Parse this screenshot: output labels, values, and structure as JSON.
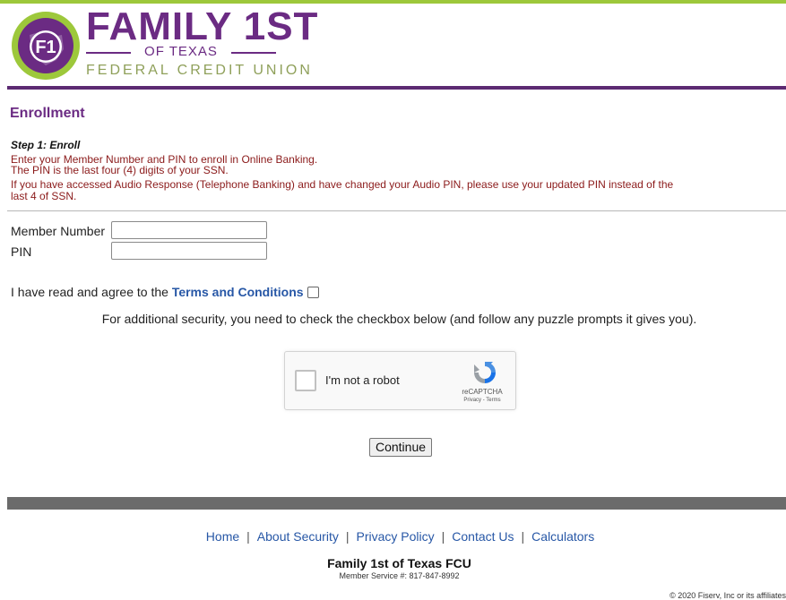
{
  "header": {
    "logo": {
      "emblem_text": "F1",
      "line1": "FAMILY 1ST",
      "line2": "OF TEXAS",
      "line3": "FEDERAL CREDIT UNION"
    }
  },
  "colors": {
    "brand_purple": "#6b2b83",
    "accent_green": "#9dc83b",
    "instruction_red": "#8b1a1a",
    "link_blue": "#2757a6"
  },
  "main": {
    "page_title": "Enrollment",
    "step_title": "Step 1: Enroll",
    "instructions": [
      "Enter your Member Number and PIN to enroll in Online Banking.",
      "The PIN is the last four (4) digits of your SSN.",
      "If you have accessed Audio Response (Telephone Banking) and have changed your Audio PIN, please use your updated PIN instead of the",
      "last 4 of SSN."
    ],
    "member_number_label": "Member Number",
    "member_number_value": "",
    "pin_label": "PIN",
    "pin_value": "",
    "terms_prefix": "I have read and agree to the ",
    "terms_link": "Terms and Conditions",
    "security_note": "For additional security, you need to check the checkbox below (and follow any puzzle prompts it gives you).",
    "recaptcha": {
      "label": "I'm not a robot",
      "brand": "reCAPTCHA",
      "privacy": "Privacy",
      "links_sep": " - ",
      "terms": "Terms"
    },
    "continue_label": "Continue"
  },
  "footer": {
    "links": [
      "Home",
      "About Security",
      "Privacy Policy",
      "Contact Us",
      "Calculators"
    ],
    "link_separator": "|",
    "org_name": "Family 1st of Texas FCU",
    "member_service": "Member Service #: 817-847-8992",
    "copyright": "© 2020 Fiserv, Inc or its affiliates"
  }
}
